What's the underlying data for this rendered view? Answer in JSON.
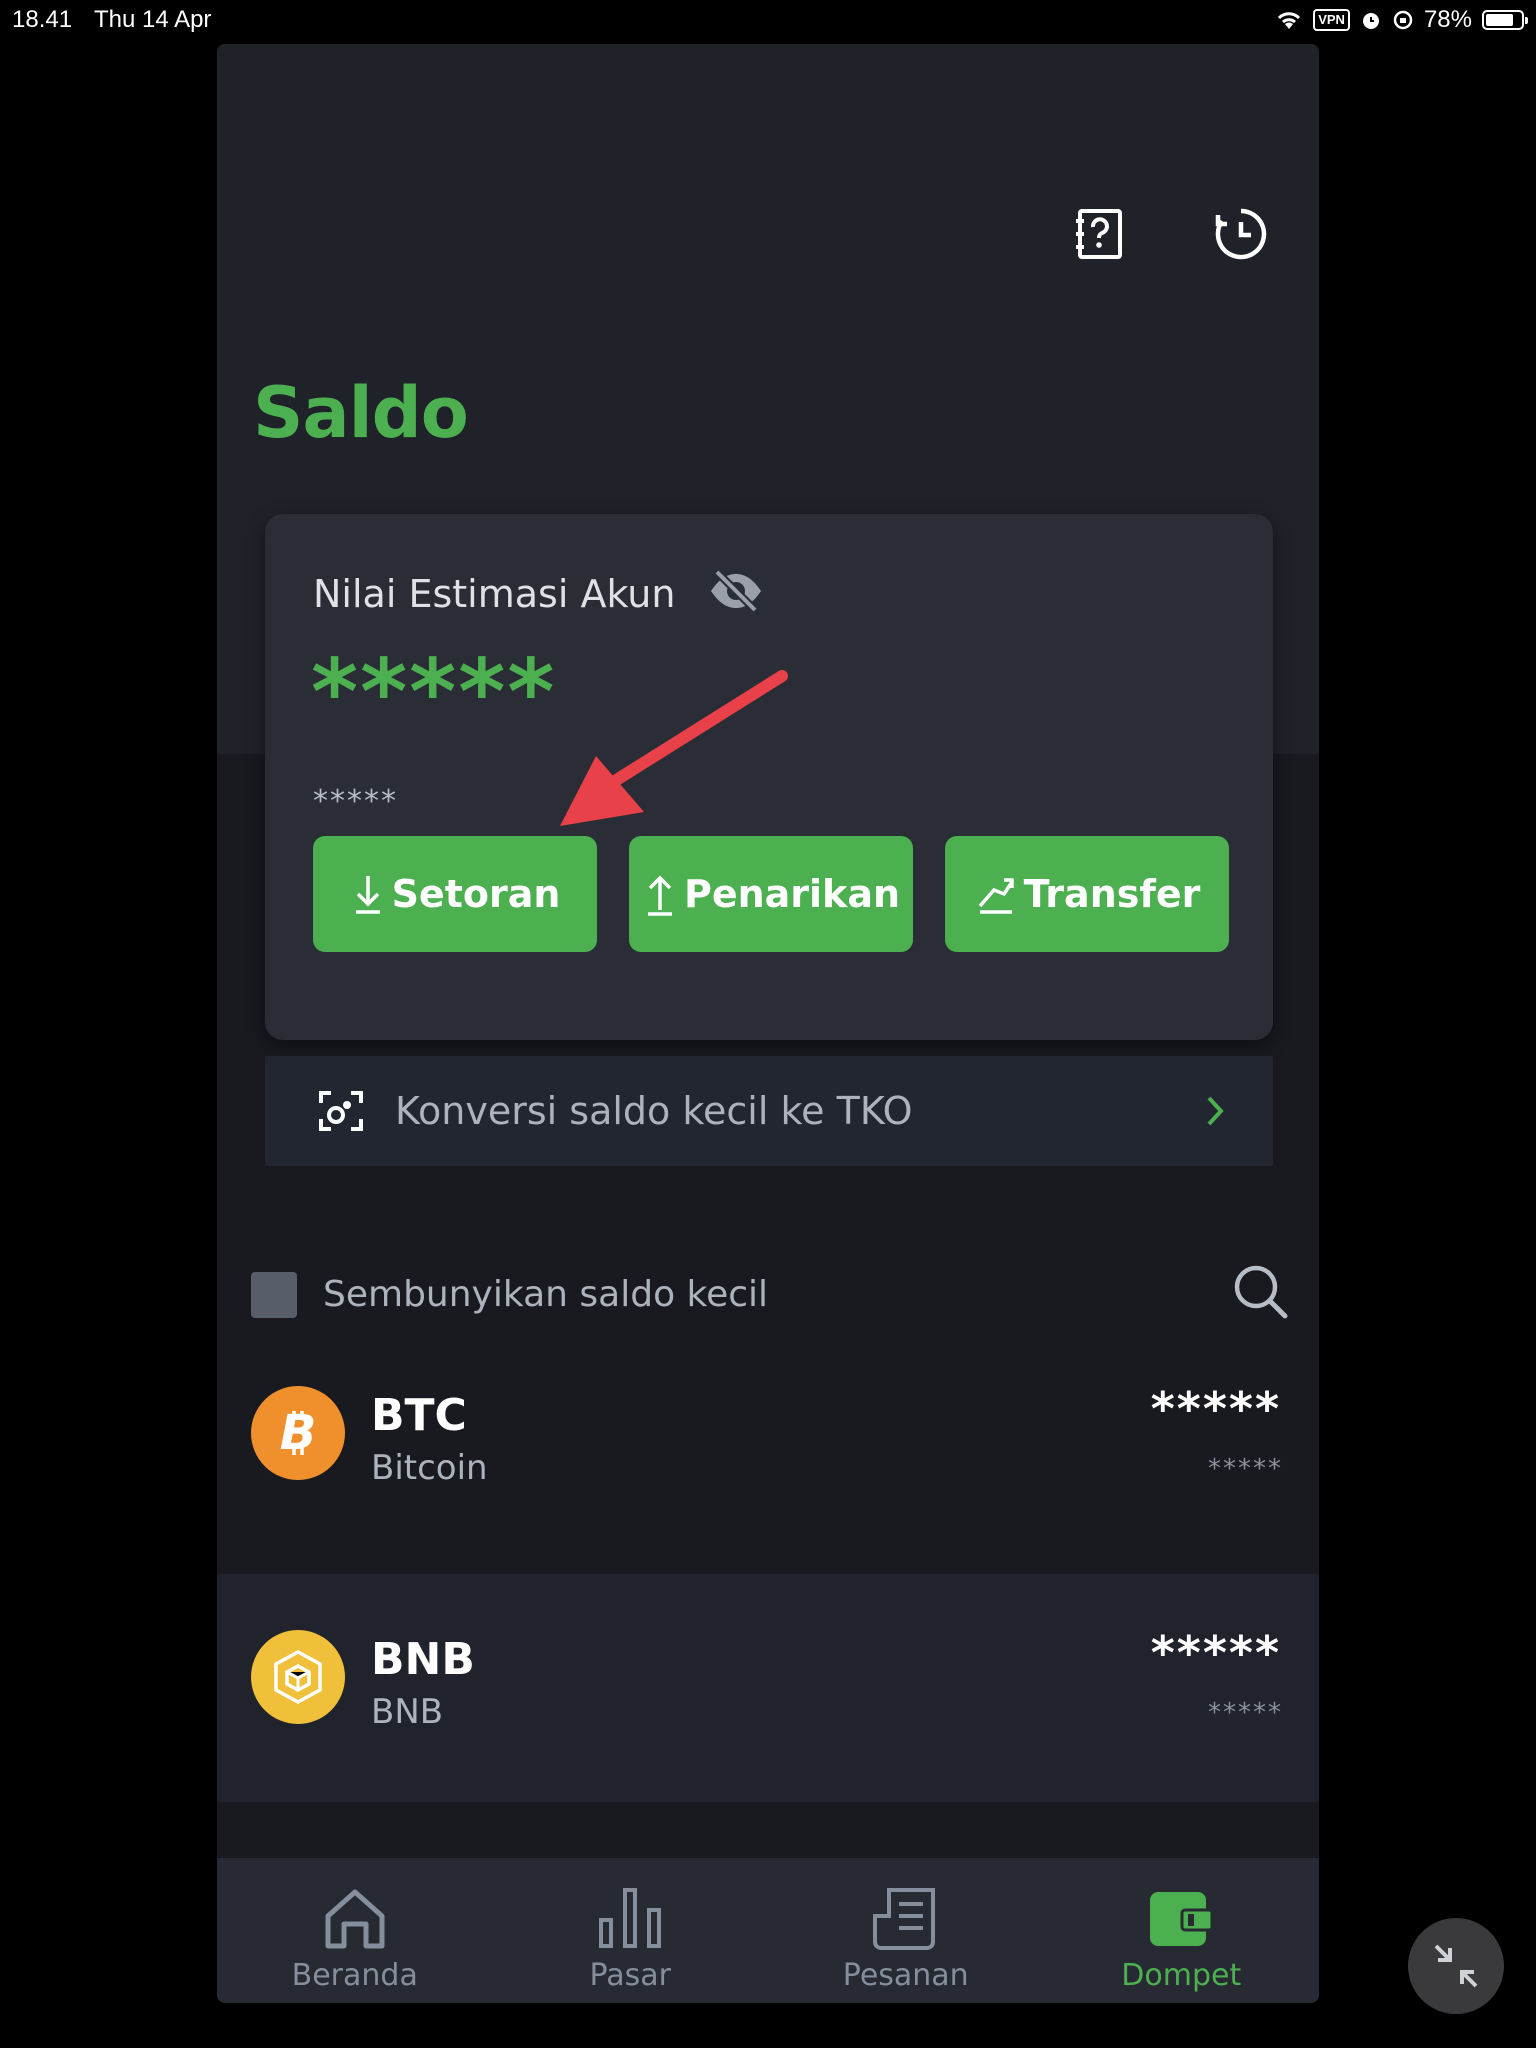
{
  "status_bar": {
    "time": "18.41",
    "date": "Thu 14 Apr",
    "vpn": "VPN",
    "battery": "78%",
    "battery_level": 0.78
  },
  "header": {
    "title": "Saldo",
    "icons": [
      "help-notebook-icon",
      "history-clock-icon"
    ]
  },
  "balance_card": {
    "label": "Nilai Estimasi Akun",
    "value_hidden": "*****",
    "sub_value_hidden": "*****",
    "actions": [
      {
        "label": "Setoran",
        "icon": "deposit-arrow-down-icon"
      },
      {
        "label": "Penarikan",
        "icon": "withdraw-arrow-up-icon"
      },
      {
        "label": "Transfer",
        "icon": "transfer-icon"
      }
    ]
  },
  "convert_row": {
    "label": "Konversi saldo kecil ke TKO"
  },
  "hide_small": {
    "label": "Sembunyikan saldo kecil",
    "checked": false
  },
  "assets": [
    {
      "symbol": "BTC",
      "name": "Bitcoin",
      "amount": "*****",
      "value": "*****",
      "color": "#f0902c"
    },
    {
      "symbol": "BNB",
      "name": "BNB",
      "amount": "*****",
      "value": "*****",
      "color": "#f0c03a"
    }
  ],
  "bottom_nav": [
    {
      "label": "Beranda",
      "icon": "home-icon"
    },
    {
      "label": "Pasar",
      "icon": "market-bars-icon"
    },
    {
      "label": "Pesanan",
      "icon": "orders-document-icon"
    },
    {
      "label": "Dompet",
      "icon": "wallet-icon",
      "active": true
    }
  ],
  "colors": {
    "accent": "#4caf50",
    "annotation_arrow": "#e8414a"
  }
}
